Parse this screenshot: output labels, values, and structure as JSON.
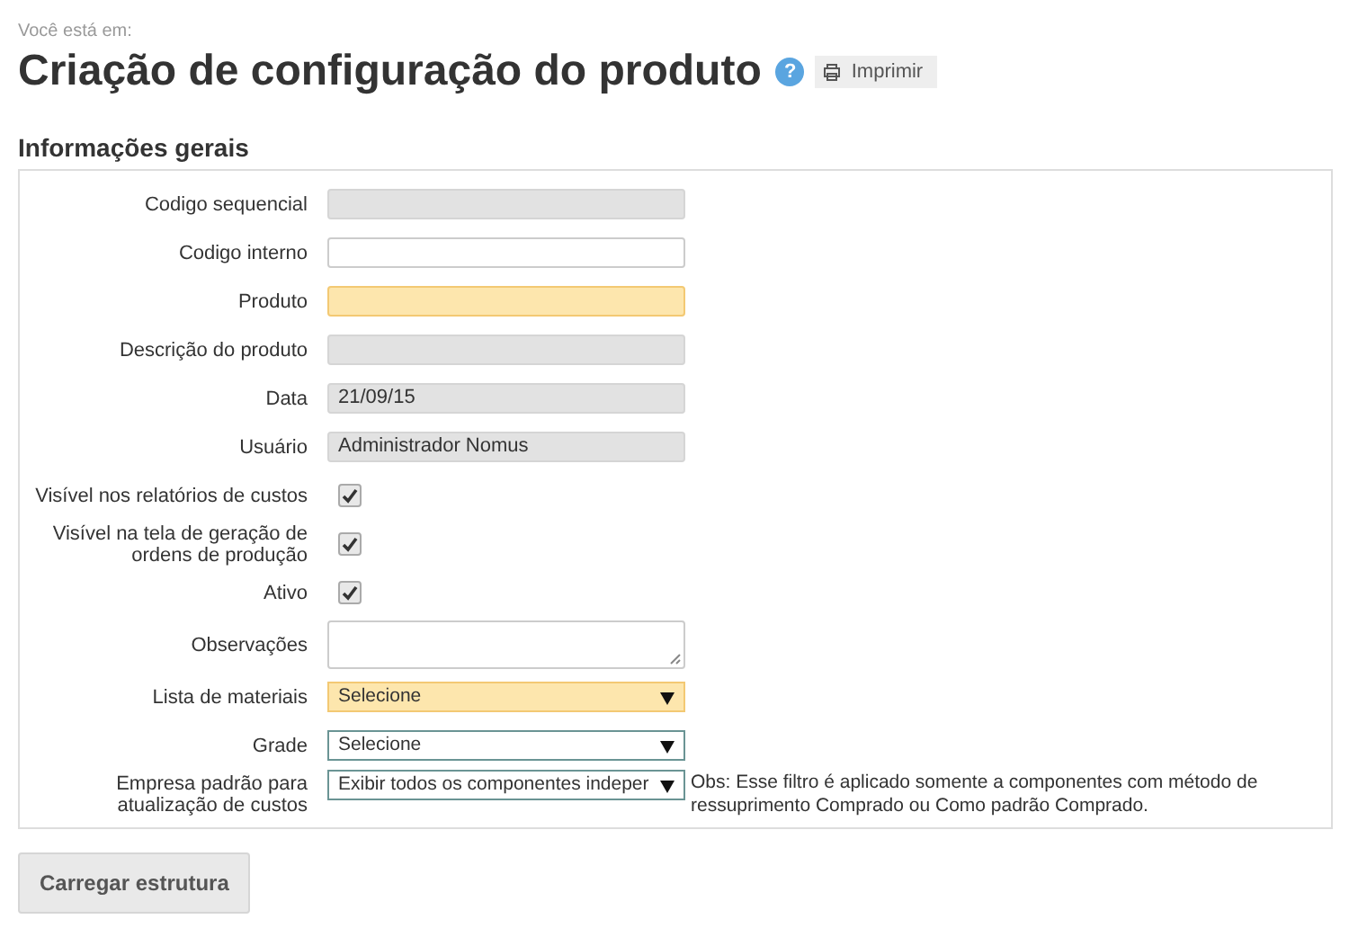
{
  "breadcrumb": "Você está em:",
  "title": "Criação de configuração do produto",
  "help_icon": "?",
  "print_button": "Imprimir",
  "section": "Informações gerais",
  "fields": [
    {
      "label": "Codigo sequencial",
      "kind": "text",
      "disabled": true,
      "required": false
    },
    {
      "label": "Codigo interno",
      "kind": "text",
      "disabled": false,
      "required": false
    },
    {
      "label": "Produto",
      "kind": "text",
      "disabled": false,
      "required": true
    },
    {
      "label": "Descrição do produto",
      "kind": "text",
      "disabled": true,
      "required": false
    },
    {
      "label": "Data",
      "kind": "text",
      "disabled": true,
      "required": false,
      "value": "21/09/15"
    },
    {
      "label": "Usuário",
      "kind": "text",
      "disabled": true,
      "required": false,
      "value": "Administrador Nomus"
    },
    {
      "label": "Visível nos relatórios de custos",
      "kind": "checkbox",
      "checked": true
    },
    {
      "label": "Visível na tela de geração de ordens de produção",
      "kind": "checkbox",
      "checked": true
    },
    {
      "label": "Ativo",
      "kind": "checkbox",
      "checked": true
    },
    {
      "label": "Observações",
      "kind": "textarea",
      "disabled": false,
      "required": false
    },
    {
      "label": "Lista de materiais",
      "kind": "select",
      "disabled": false,
      "required": true,
      "value": "Selecione"
    },
    {
      "label": "Grade",
      "kind": "select",
      "disabled": false,
      "required": false,
      "value": "Selecione"
    },
    {
      "label": "Empresa padrão para atualização de custos",
      "kind": "select",
      "disabled": false,
      "required": false,
      "value": "Exibir todos os componentes indeper",
      "note": "Obs: Esse filtro é aplicado somente a componentes com método de ressuprimento Comprado ou Como padrão Comprado."
    }
  ],
  "load_button": "Carregar estrutura"
}
